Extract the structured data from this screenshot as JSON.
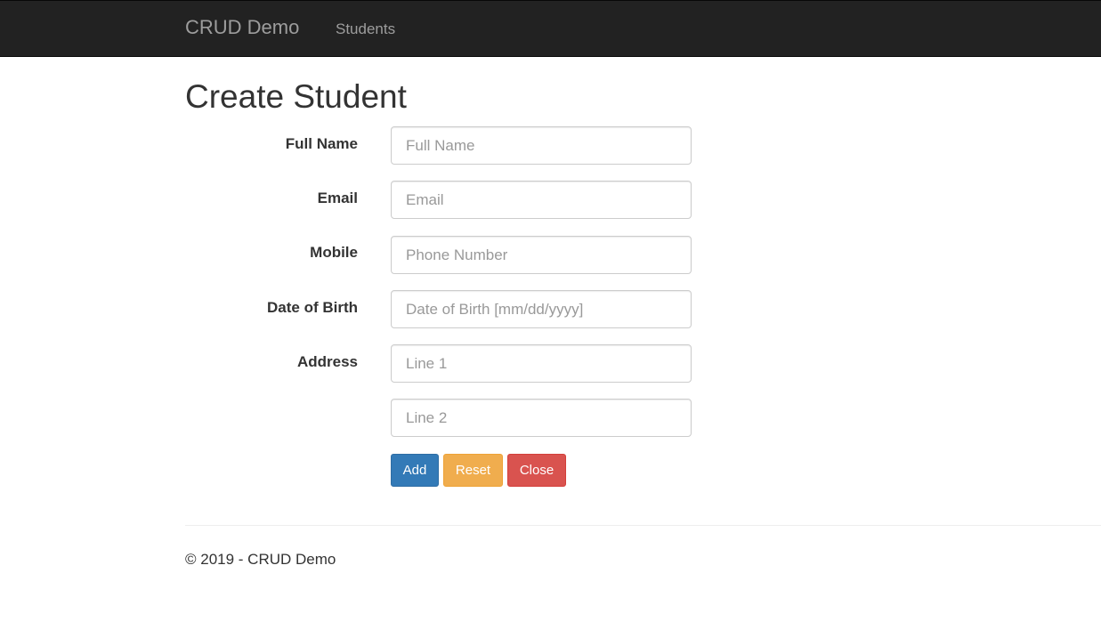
{
  "navbar": {
    "brand": "CRUD Demo",
    "links": [
      "Students"
    ]
  },
  "page": {
    "title": "Create Student"
  },
  "form": {
    "fields": [
      {
        "label": "Full Name",
        "placeholder": "Full Name",
        "value": ""
      },
      {
        "label": "Email",
        "placeholder": "Email",
        "value": ""
      },
      {
        "label": "Mobile",
        "placeholder": "Phone Number",
        "value": ""
      },
      {
        "label": "Date of Birth",
        "placeholder": "Date of Birth [mm/dd/yyyy]",
        "value": ""
      },
      {
        "label": "Address",
        "placeholder": "Line 1",
        "value": ""
      },
      {
        "label": "",
        "placeholder": "Line 2",
        "value": ""
      }
    ],
    "buttons": {
      "add": "Add",
      "reset": "Reset",
      "close": "Close"
    }
  },
  "footer": {
    "text": "© 2019 - CRUD Demo"
  },
  "colors": {
    "navbar_bg": "#222222",
    "primary": "#337ab7",
    "warning": "#f0ad4e",
    "danger": "#d9534f"
  }
}
